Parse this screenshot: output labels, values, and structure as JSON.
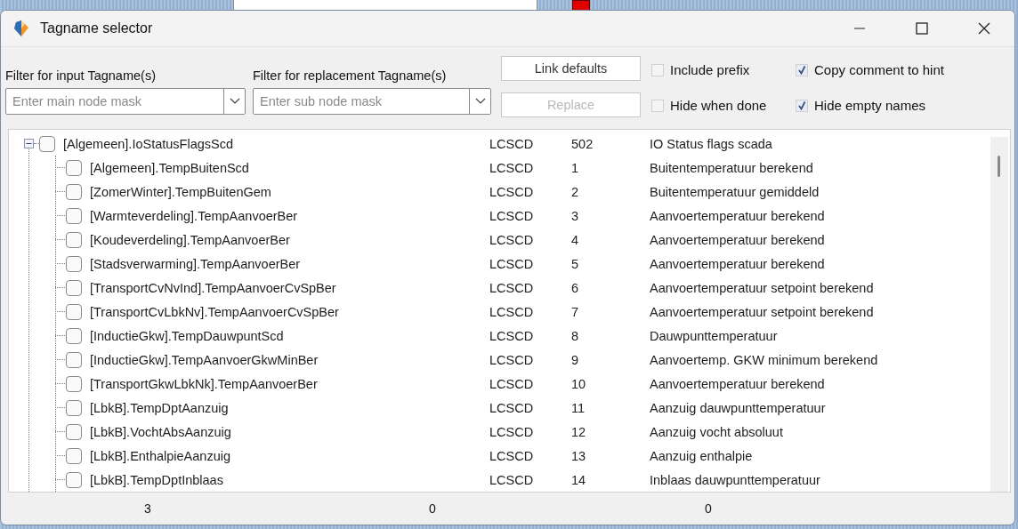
{
  "window": {
    "title": "Tagname selector"
  },
  "filters": [
    {
      "label": "Filter for input Tagname(s)",
      "placeholder": "Enter main node mask"
    },
    {
      "label": "Filter for replacement Tagname(s)",
      "placeholder": "Enter sub node mask"
    }
  ],
  "buttons": [
    {
      "label": "Link defaults",
      "disabled": false
    },
    {
      "label": "Replace",
      "disabled": true
    }
  ],
  "options": [
    {
      "label": "Include prefix",
      "checked": false
    },
    {
      "label": "Copy comment to hint",
      "checked": true
    },
    {
      "label": "Hide when done",
      "checked": false
    },
    {
      "label": "Hide empty names",
      "checked": true
    }
  ],
  "tree": [
    {
      "name": "[Algemeen].IoStatusFlagsScd",
      "type": "LCSCD",
      "number": "502",
      "description": "IO Status flags scada",
      "checked": false,
      "expanded": true,
      "children": [
        {
          "name": "[Algemeen].TempBuitenScd",
          "type": "LCSCD",
          "number": "1",
          "description": "Buitentemperatuur berekend",
          "checked": false
        },
        {
          "name": "[ZomerWinter].TempBuitenGem",
          "type": "LCSCD",
          "number": "2",
          "description": "Buitentemperatuur gemiddeld",
          "checked": false
        },
        {
          "name": "[Warmteverdeling].TempAanvoerBer",
          "type": "LCSCD",
          "number": "3",
          "description": "Aanvoertemperatuur berekend",
          "checked": false
        },
        {
          "name": "[Koudeverdeling].TempAanvoerBer",
          "type": "LCSCD",
          "number": "4",
          "description": "Aanvoertemperatuur berekend",
          "checked": false
        },
        {
          "name": "[Stadsverwarming].TempAanvoerBer",
          "type": "LCSCD",
          "number": "5",
          "description": "Aanvoertemperatuur berekend",
          "checked": false
        },
        {
          "name": "[TransportCvNvInd].TempAanvoerCvSpBer",
          "type": "LCSCD",
          "number": "6",
          "description": "Aanvoertemperatuur setpoint berekend",
          "checked": false
        },
        {
          "name": "[TransportCvLbkNv].TempAanvoerCvSpBer",
          "type": "LCSCD",
          "number": "7",
          "description": "Aanvoertemperatuur setpoint berekend",
          "checked": false
        },
        {
          "name": "[InductieGkw].TempDauwpuntScd",
          "type": "LCSCD",
          "number": "8",
          "description": "Dauwpunttemperatuur",
          "checked": false
        },
        {
          "name": "[InductieGkw].TempAanvoerGkwMinBer",
          "type": "LCSCD",
          "number": "9",
          "description": "Aanvoertemp. GKW minimum berekend",
          "checked": false
        },
        {
          "name": "[TransportGkwLbkNk].TempAanvoerBer",
          "type": "LCSCD",
          "number": "10",
          "description": "Aanvoertemperatuur berekend",
          "checked": false
        },
        {
          "name": "[LbkB].TempDptAanzuig",
          "type": "LCSCD",
          "number": "11",
          "description": "Aanzuig dauwpunttemperatuur",
          "checked": false
        },
        {
          "name": "[LbkB].VochtAbsAanzuig",
          "type": "LCSCD",
          "number": "12",
          "description": "Aanzuig vocht absoluut",
          "checked": false
        },
        {
          "name": "[LbkB].EnthalpieAanzuig",
          "type": "LCSCD",
          "number": "13",
          "description": "Aanzuig enthalpie",
          "checked": false
        },
        {
          "name": "[LbkB].TempDptInblaas",
          "type": "LCSCD",
          "number": "14",
          "description": "Inblaas dauwpunttemperatuur",
          "checked": false
        }
      ]
    }
  ],
  "status_bar": [
    "3",
    "0",
    "0"
  ]
}
